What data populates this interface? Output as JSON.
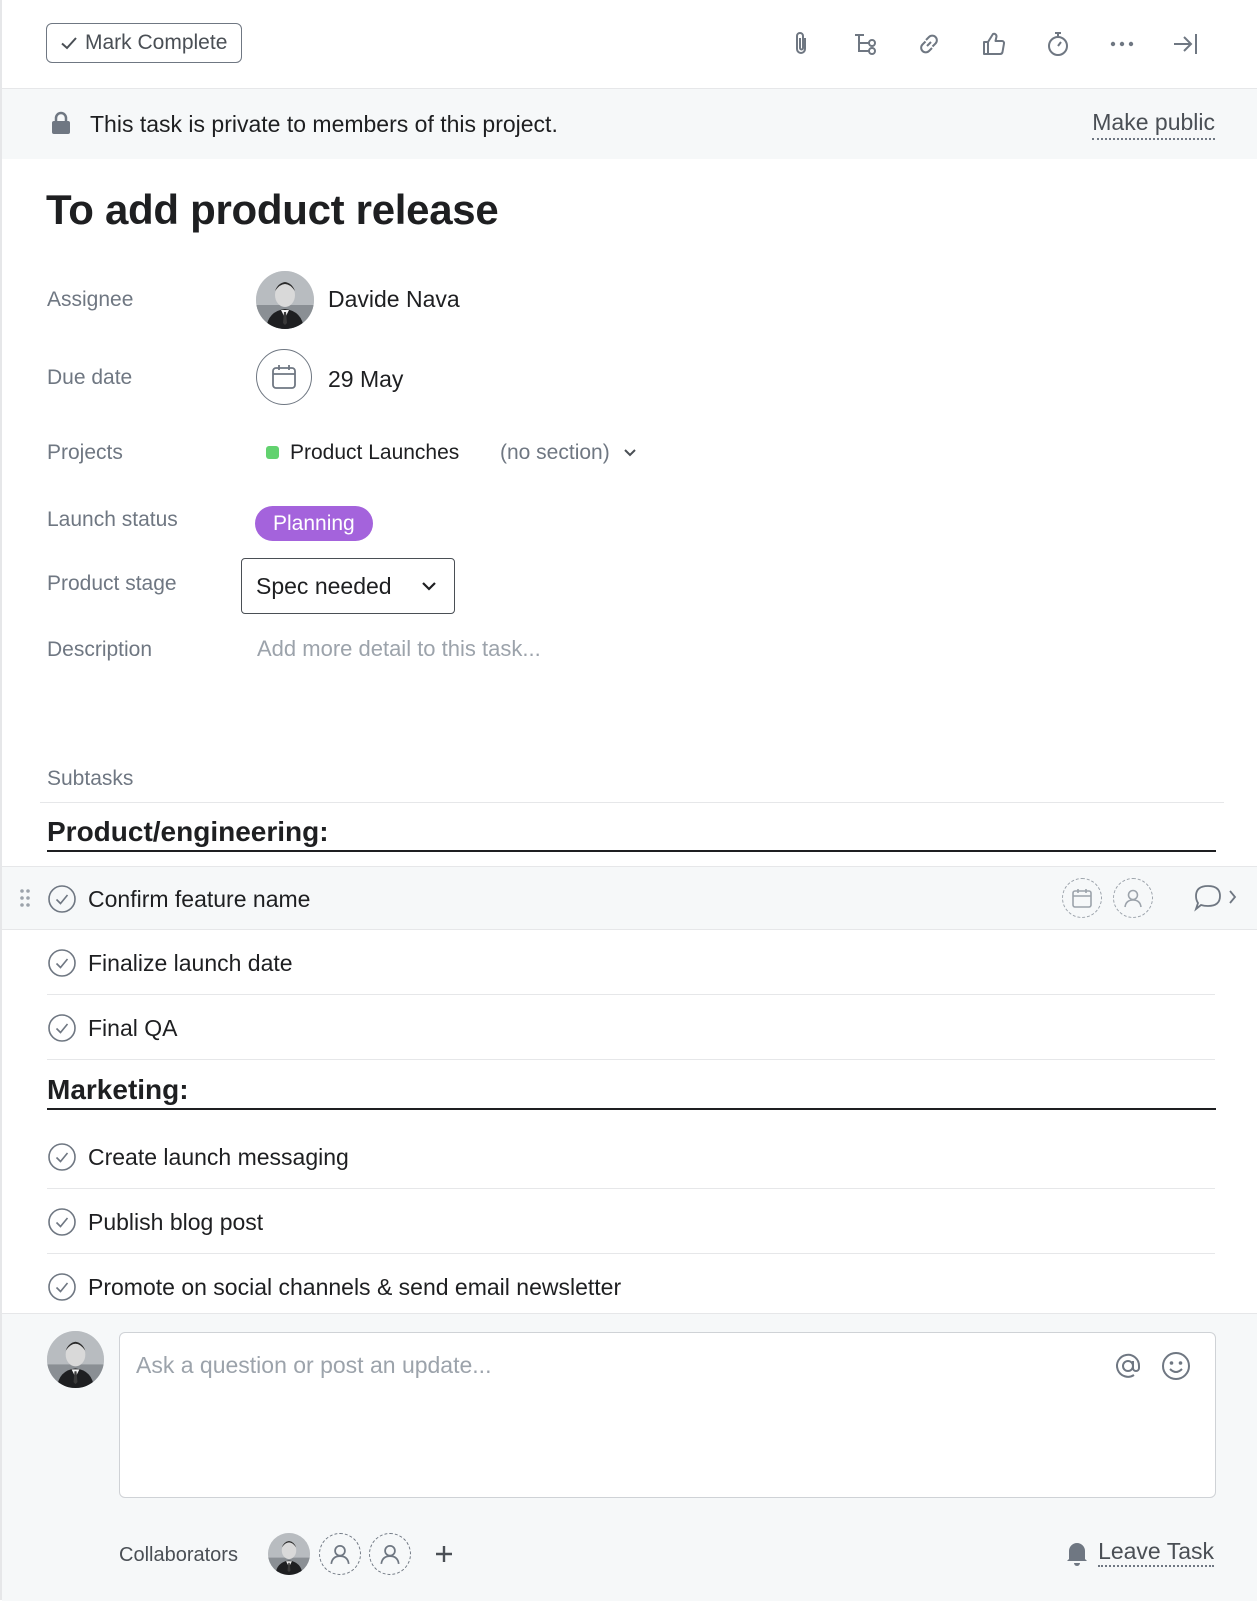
{
  "toolbar": {
    "mark_complete_label": "Mark Complete",
    "icons": [
      "paperclip-icon",
      "subtask-icon",
      "link-icon",
      "thumbs-up-icon",
      "timer-icon",
      "more-icon",
      "close-pane-icon"
    ]
  },
  "banner": {
    "text": "This task is private to members of this project.",
    "make_public_label": "Make public"
  },
  "task": {
    "title": "To add product release",
    "fields": {
      "assignee_label": "Assignee",
      "assignee_name": "Davide Nava",
      "due_label": "Due date",
      "due_value": "29 May",
      "projects_label": "Projects",
      "project_name": "Product Launches",
      "project_color": "#62d26f",
      "project_section": "(no section)",
      "launch_status_label": "Launch status",
      "launch_status_value": "Planning",
      "launch_status_color": "#a463dc",
      "product_stage_label": "Product stage",
      "product_stage_value": "Spec needed",
      "description_label": "Description",
      "description_placeholder": "Add more detail to this task..."
    }
  },
  "subtasks": {
    "label": "Subtasks",
    "sections": [
      {
        "title": "Product/engineering:",
        "items": [
          "Confirm feature name",
          "Finalize launch date",
          "Final QA"
        ]
      },
      {
        "title": "Marketing:",
        "items": [
          "Create launch messaging",
          "Publish blog post",
          "Promote on social channels & send email newsletter"
        ]
      }
    ]
  },
  "comment": {
    "placeholder": "Ask a question or post an update..."
  },
  "collaborators": {
    "label": "Collaborators",
    "leave_label": "Leave Task"
  }
}
